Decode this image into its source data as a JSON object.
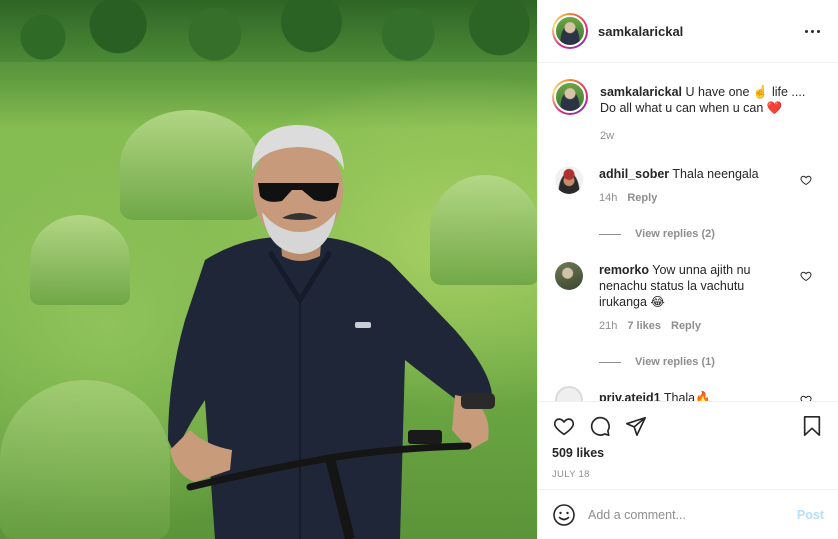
{
  "header": {
    "username": "samkalarickal"
  },
  "caption": {
    "username": "samkalarickal",
    "text_a": "U have one ",
    "emoji_a": "☝️",
    "text_b": " life .... Do all what u can when u can ",
    "emoji_b": "❤️",
    "time": "2w"
  },
  "comments": [
    {
      "username": "adhil_sober",
      "text": "Thala neengala",
      "time": "14h",
      "likes": "",
      "reply_label": "Reply",
      "view_replies": "View replies (2)"
    },
    {
      "username": "remorko",
      "text": "Yow unna ajith nu nenachu status la vachutu irukanga 😂",
      "time": "21h",
      "likes": "7 likes",
      "reply_label": "Reply",
      "view_replies": "View replies (1)"
    },
    {
      "username": "priv.ateid1",
      "text": "Thala🔥"
    }
  ],
  "likes": "509 likes",
  "date": "JULY 18",
  "composer": {
    "placeholder": "Add a comment...",
    "post_label": "Post"
  },
  "icons": {
    "more": "more-horizontal-icon",
    "like": "heart-icon",
    "comment": "comment-icon",
    "share": "share-icon",
    "save": "bookmark-icon",
    "emoji": "emoji-icon"
  },
  "colors": {
    "accent_link": "#0095f6",
    "post_disabled": "#b2dffc",
    "muted_text": "#8e8e8e",
    "heart_emoji": "#e0245e"
  }
}
